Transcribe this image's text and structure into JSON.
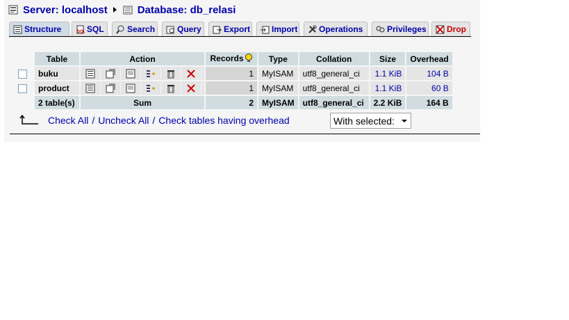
{
  "breadcrumb": {
    "server_label": "Server: localhost",
    "database_label": "Database: db_relasi"
  },
  "tabs": [
    {
      "label": "Structure",
      "icon": "structure-icon",
      "active": true
    },
    {
      "label": "SQL",
      "icon": "sql-icon"
    },
    {
      "label": "Search",
      "icon": "search-icon"
    },
    {
      "label": "Query",
      "icon": "query-icon"
    },
    {
      "label": "Export",
      "icon": "export-icon"
    },
    {
      "label": "Import",
      "icon": "import-icon"
    },
    {
      "label": "Operations",
      "icon": "operations-icon"
    },
    {
      "label": "Privileges",
      "icon": "privileges-icon"
    },
    {
      "label": "Drop",
      "icon": "drop-icon"
    }
  ],
  "table": {
    "headers": [
      "Table",
      "Action",
      "Records",
      "Type",
      "Collation",
      "Size",
      "Overhead"
    ],
    "rows": [
      {
        "name": "buku",
        "records": "1",
        "type": "MyISAM",
        "collation": "utf8_general_ci",
        "size": "1.1 KiB",
        "overhead": "104 B"
      },
      {
        "name": "product",
        "records": "1",
        "type": "MyISAM",
        "collation": "utf8_general_ci",
        "size": "1.1 KiB",
        "overhead": "60 B"
      }
    ],
    "footer": {
      "name": "2 table(s)",
      "action": "Sum",
      "records": "2",
      "type": "MyISAM",
      "collation": "utf8_general_ci",
      "size": "2.2 KiB",
      "overhead": "164 B"
    }
  },
  "bulk": {
    "check_all": "Check All",
    "uncheck_all": "Uncheck All",
    "check_overhead": "Check tables having overhead",
    "separator": "/",
    "with_selected": "With selected:"
  },
  "colors": {
    "link": "#0000aa",
    "drop": "#cc0000",
    "header_bg": "#d0dce0",
    "row_bg": "#e5e5e5"
  }
}
